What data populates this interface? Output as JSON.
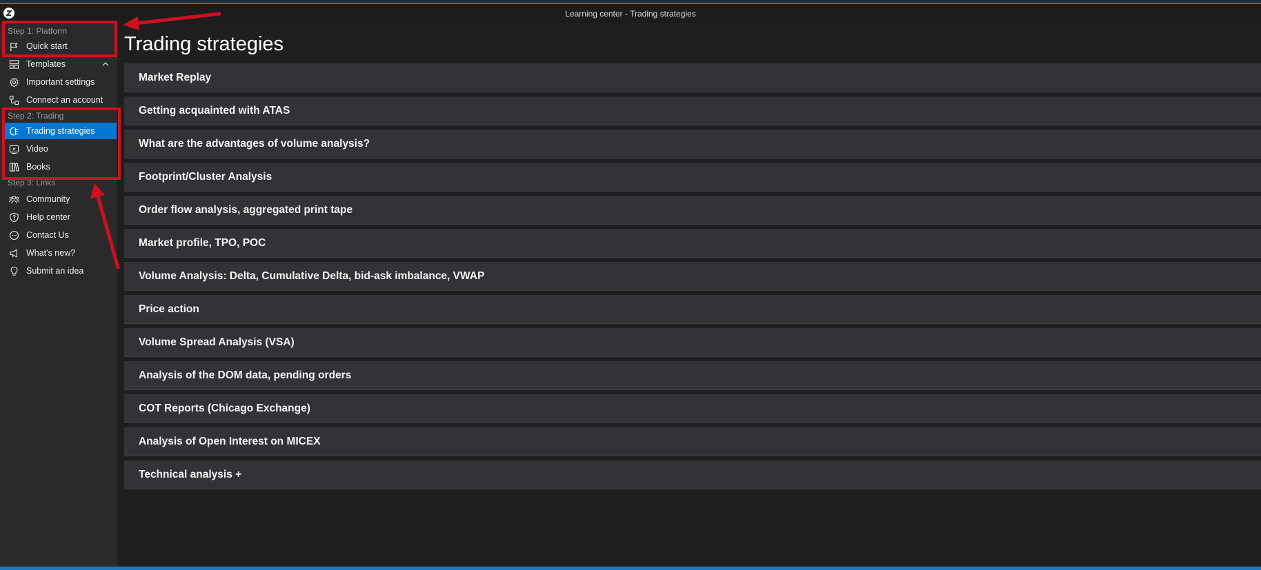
{
  "window": {
    "title": "Learning center - Trading strategies"
  },
  "sidebar": {
    "steps": [
      {
        "label": "Step 1: Platform",
        "items": [
          {
            "label": "Quick start",
            "icon": "flag-icon"
          },
          {
            "label": "Templates",
            "icon": "layout-icon",
            "expander": "chevron-up-icon"
          },
          {
            "label": "Important settings",
            "icon": "gear-icon"
          },
          {
            "label": "Connect an account",
            "icon": "connect-icon"
          }
        ]
      },
      {
        "label": "Step 2: Trading",
        "items": [
          {
            "label": "Trading strategies",
            "icon": "strategy-icon",
            "selected": true
          },
          {
            "label": "Video",
            "icon": "video-icon"
          },
          {
            "label": "Books",
            "icon": "books-icon"
          }
        ]
      },
      {
        "label": "Step 3: Links",
        "items": [
          {
            "label": "Community",
            "icon": "community-icon"
          },
          {
            "label": "Help center",
            "icon": "help-shield-icon"
          },
          {
            "label": "Contact Us",
            "icon": "chat-icon"
          },
          {
            "label": "What's new?",
            "icon": "megaphone-icon"
          },
          {
            "label": "Submit an idea",
            "icon": "lightbulb-icon"
          }
        ]
      }
    ]
  },
  "main": {
    "title": "Trading strategies",
    "strategies": [
      "Market Replay",
      "Getting acquainted with ATAS",
      "What are the advantages of volume analysis?",
      "Footprint/Cluster Analysis",
      "Order flow analysis, aggregated print tape",
      "Market profile, TPO, POC",
      "Volume Analysis: Delta, Cumulative Delta, bid-ask imbalance, VWAP",
      "Price action",
      "Volume Spread Analysis (VSA)",
      "Analysis of the DOM data, pending orders",
      "COT Reports (Chicago Exchange)",
      "Analysis of Open Interest on MICEX",
      "Technical analysis +"
    ]
  },
  "colors": {
    "accent": "#0078d4",
    "annotation": "#cf1020",
    "sidebar_bg": "#2a2a2a",
    "item_bg": "#333337"
  }
}
